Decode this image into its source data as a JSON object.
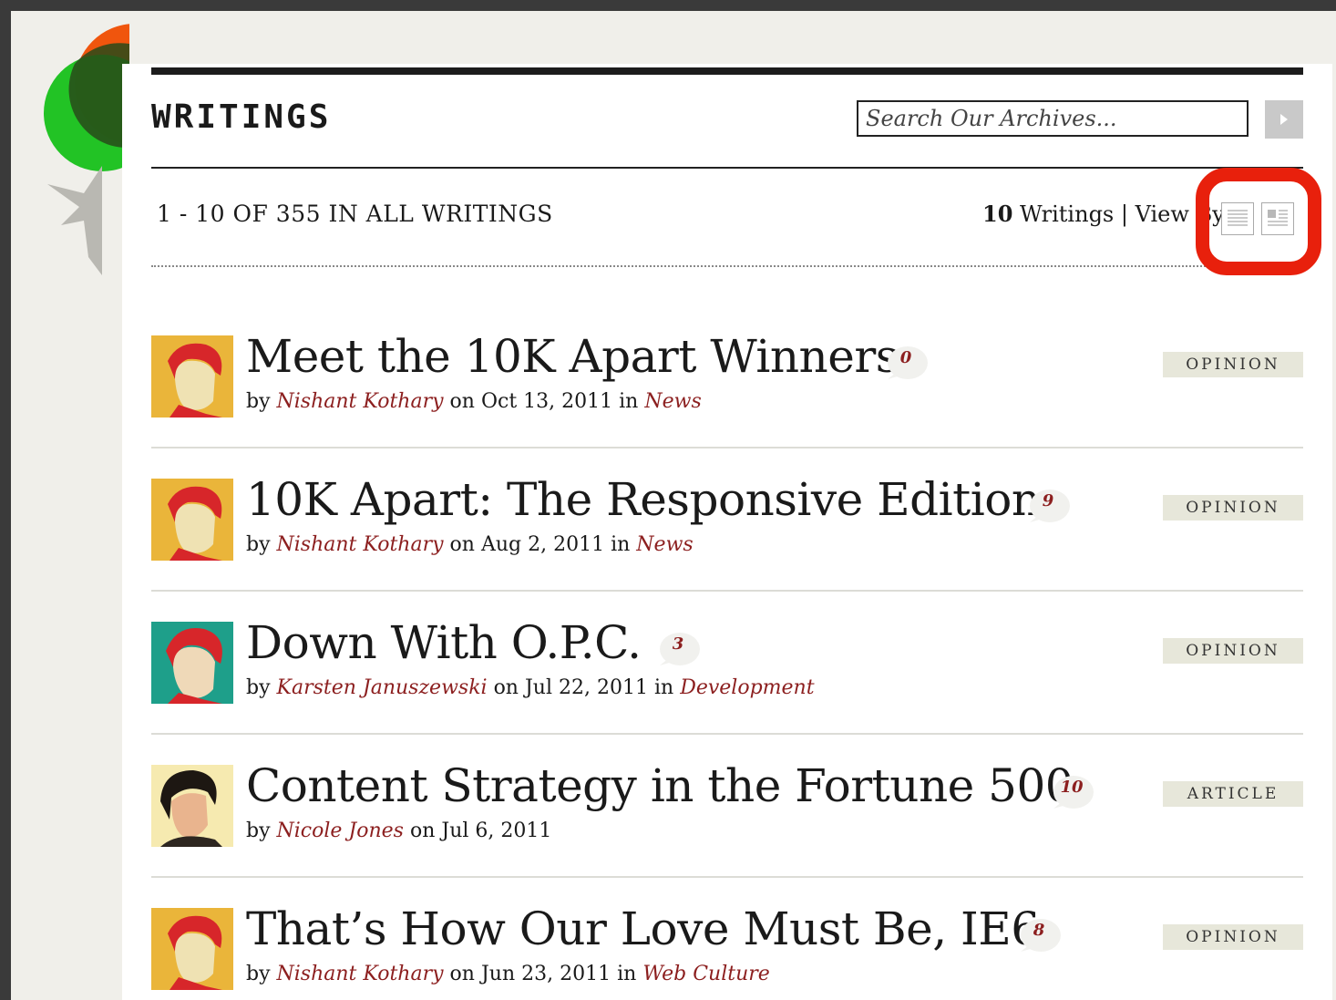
{
  "header": {
    "title": "WRITINGS",
    "search_placeholder": "Search Our Archives..."
  },
  "results": {
    "range_text": "1 - 10 OF 355 IN ALL WRITINGS",
    "count_label": "10",
    "count_suffix": "Writings | View By"
  },
  "entries": [
    {
      "title": "Meet the 10K Apart Winners",
      "comments": "0",
      "author": "Nishant Kothary",
      "date": "Oct 13, 2011",
      "category": "News",
      "type": "OPINION"
    },
    {
      "title": "10K Apart: The Responsive Edition",
      "comments": "9",
      "author": "Nishant Kothary",
      "date": "Aug 2, 2011",
      "category": "News",
      "type": "OPINION"
    },
    {
      "title": "Down With O.P.C.",
      "comments": "3",
      "author": "Karsten Januszewski",
      "date": "Jul 22, 2011",
      "category": "Development",
      "type": "OPINION"
    },
    {
      "title": "Content Strategy in the Fortune 500",
      "comments": "10",
      "author": "Nicole Jones",
      "date": "Jul 6, 2011",
      "category": "",
      "type": "ARTICLE"
    },
    {
      "title": "That’s How Our Love Must Be, IE6",
      "comments": "8",
      "author": "Nishant Kothary",
      "date": "Jun 23, 2011",
      "category": "Web Culture",
      "type": "OPINION"
    }
  ],
  "byline_words": {
    "by": "by",
    "on": "on",
    "in": "in"
  },
  "colors": {
    "accent_link": "#8c1f1f",
    "highlight_ring": "#e8200c",
    "badge_bg": "#e7e7da"
  }
}
